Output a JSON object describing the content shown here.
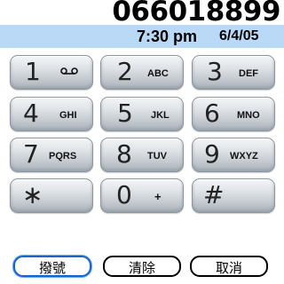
{
  "display": {
    "number": "066018899",
    "time": "7:30 pm",
    "date": "6/4/05"
  },
  "keypad": {
    "keys": [
      {
        "digit": "1",
        "letters": "",
        "icon": "voicemail-icon"
      },
      {
        "digit": "2",
        "letters": "ABC"
      },
      {
        "digit": "3",
        "letters": "DEF"
      },
      {
        "digit": "4",
        "letters": "GHI"
      },
      {
        "digit": "5",
        "letters": "JKL"
      },
      {
        "digit": "6",
        "letters": "MNO"
      },
      {
        "digit": "7",
        "letters": "PQRS"
      },
      {
        "digit": "8",
        "letters": "TUV"
      },
      {
        "digit": "9",
        "letters": "WXYZ"
      },
      {
        "digit": "∗",
        "letters": ""
      },
      {
        "digit": "0",
        "letters": "+"
      },
      {
        "digit": "#",
        "letters": ""
      }
    ]
  },
  "buttons": {
    "dial": "撥號",
    "clear": "清除",
    "cancel": "取消"
  },
  "colors": {
    "status_bar": "#b9d9f6",
    "selected_button_border": "#1a66c8"
  }
}
